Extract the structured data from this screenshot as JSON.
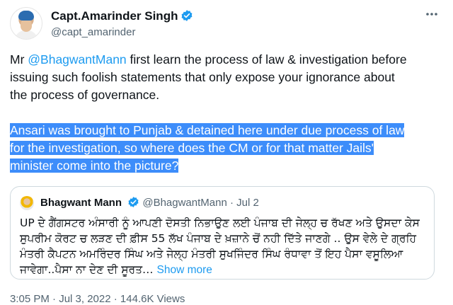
{
  "author": {
    "display_name": "Capt.Amarinder Singh",
    "handle": "@capt_amarinder",
    "verified_color": "#1d9bf0"
  },
  "menu_icon": "more-horizontal-icon",
  "tweet": {
    "p1_prefix": "Mr ",
    "p1_mention": "@BhagwantMann",
    "p1_line1_rest": " first learn the process of law & investigation before",
    "p1_line2": "issuing such foolish statements that only expose your ignorance about",
    "p1_line3": "the process of governance.",
    "p2_line1": "Ansari was brought to Punjab & detained here under due process of law",
    "p2_line2": "for the investigation, so where does the CM or for that matter Jails'",
    "p2_line3": "minister come into the picture?"
  },
  "quoted": {
    "display_name": "Bhagwant Mann",
    "handle": "@BhagwantMann",
    "separator": " · ",
    "date": "Jul 2",
    "line1": "UP ਦੇ ਗੈਂਗਸਟਰ ਅੰਸਾਰੀ ਨੂੰ ਆਪਣੀ ਦੋਸਤੀ ਨਿਭਾਉਣ ਲਈ ਪੰਜਾਬ ਦੀ ਜੇਲ੍ਹ ਚ ਰੱਖਣ ਅਤੇ ਉਸਦਾ ਕੇਸ",
    "line2": "ਸੁਪਰੀਮ ਕੋਰਟ ਚ ਲੜਣ ਦੀ ਫ਼ੀਸ 55 ਲੱਖ ਪੰਜਾਬ ਦੇ ਖ਼ਜ਼ਾਨੇ ਚੋਂ ਨਹੀ ਦਿੱਤੇ ਜਾਣਗੇ .. ਉਸ ਵੇਲੇ ਦੇ ਗ੍ਰਹਿ",
    "line3": "ਮੰਤਰੀ ਕੈਪਟਨ ਅਮਰਿੰਦਰ ਸਿੰਘ ਅਤੇ ਜੇਲ੍ਹ ਮੰਤਰੀ ਸੁਖਜਿੰਦਰ ਸਿੰਘ ਰੰਧਾਵਾ ਤੋਂ ਇਹ ਪੈਸਾ ਵਸੂਲਿਆ",
    "line4": "ਜਾਵੇਗਾ..ਪੈਸਾ ਨਾ ਦੇਣ ਦੀ ਸੂਰਤ",
    "ellipsis": "… ",
    "show_more": "Show more"
  },
  "footer": {
    "partial": "3:05 PM · Jul 3, 2022 · 144.6K Views"
  },
  "colors": {
    "link": "#1d9bf0",
    "highlight": "#3d8dfa",
    "muted": "#536471"
  }
}
